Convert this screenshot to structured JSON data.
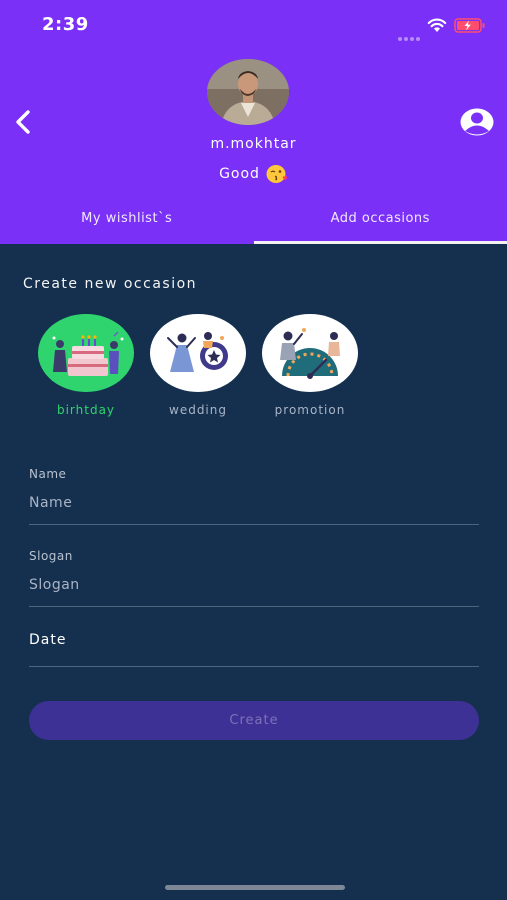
{
  "status_bar": {
    "time": "2:39",
    "wifi_icon": "wifi-icon",
    "battery_icon": "battery-charging-icon"
  },
  "header": {
    "background_color": "#7a30f6",
    "back_icon": "chevron-left-icon",
    "profile_icon": "user-circle-icon",
    "username": "m.mokhtar",
    "status_text": "Good",
    "status_emoji": "kiss-emoji"
  },
  "tabs": [
    {
      "label": "My wishlist`s",
      "active": false
    },
    {
      "label": "Add occasions",
      "active": true
    }
  ],
  "form": {
    "section_title": "Create new occasion",
    "occasions": [
      {
        "label": "birhtday",
        "selected": true
      },
      {
        "label": "wedding",
        "selected": false
      },
      {
        "label": "promotion",
        "selected": false
      }
    ],
    "name": {
      "label": "Name",
      "placeholder": "Name",
      "value": ""
    },
    "slogan": {
      "label": "Slogan",
      "placeholder": "Slogan",
      "value": ""
    },
    "date": {
      "label": "Date"
    },
    "create_label": "Create"
  },
  "colors": {
    "accent_purple": "#7a30f6",
    "background_navy": "#14304e",
    "selected_green": "#2fd46e",
    "button_disabled": "#3e3196"
  }
}
